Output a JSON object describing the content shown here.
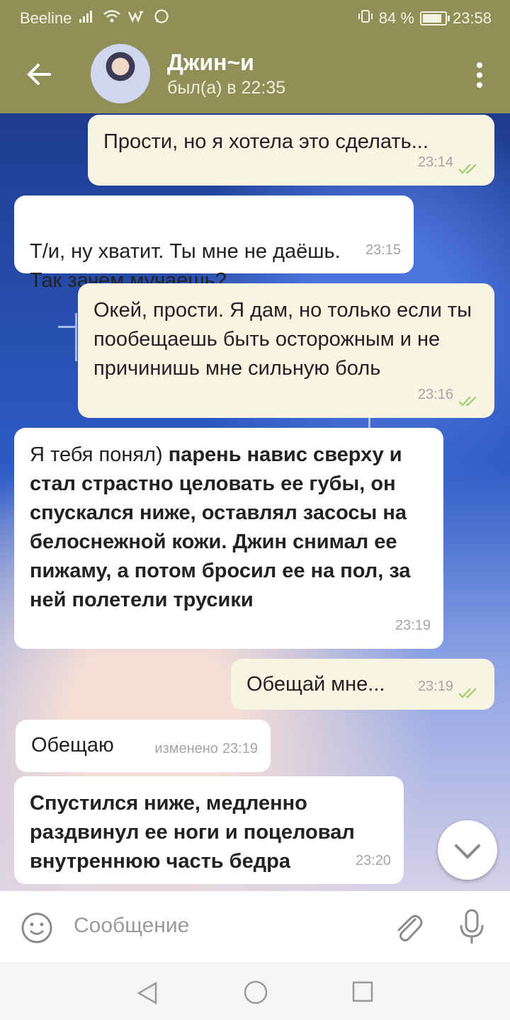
{
  "status_bar": {
    "carrier": "Beeline",
    "battery": "84 %",
    "time": "23:58"
  },
  "header": {
    "contact_name": "Джин~и",
    "last_seen": "был(а) в 22:35"
  },
  "messages": [
    {
      "direction": "out",
      "text": "Прости, но я хотела это сделать...",
      "time": "23:14",
      "read": true
    },
    {
      "direction": "in",
      "text": "Т/и, ну хватит. Ты мне не даёшь.\nТак зачем мучаешь?",
      "time": "23:15"
    },
    {
      "direction": "out",
      "text": "Окей, прости. Я дам, но только если ты пообещаешь быть осторожным и не причинишь мне сильную боль",
      "time": "23:16",
      "read": true
    },
    {
      "direction": "in",
      "text_normal": "Я тебя понял) ",
      "text_bold": "парень навис сверху и стал страстно целовать ее губы, он спускался ниже, оставлял засосы на белоснежной кожи. Джин снимал ее пижаму, а потом бросил ее на пол, за ней полетели трусики",
      "time": "23:19"
    },
    {
      "direction": "out",
      "text": "Обещай мне...",
      "time": "23:19",
      "read": true
    },
    {
      "direction": "in",
      "text": "Обещаю",
      "edited_label": "изменено",
      "time": "23:19"
    },
    {
      "direction": "in",
      "text_bold": "Спустился ниже, медленно раздвинул ее ноги и поцеловал внутреннюю часть  бедра",
      "time": "23:20"
    }
  ],
  "input": {
    "placeholder": "Сообщение"
  },
  "colors": {
    "header": "#8f8f57",
    "bubble_out": "#f7f4e2",
    "bubble_in": "#ffffff",
    "check": "#9fcf6a"
  },
  "icons": [
    "back-arrow-icon",
    "more-vertical-icon",
    "emoji-icon",
    "attach-icon",
    "mic-icon",
    "chevron-down-icon",
    "nav-back-icon",
    "nav-home-icon",
    "nav-recent-icon",
    "double-check-icon"
  ]
}
